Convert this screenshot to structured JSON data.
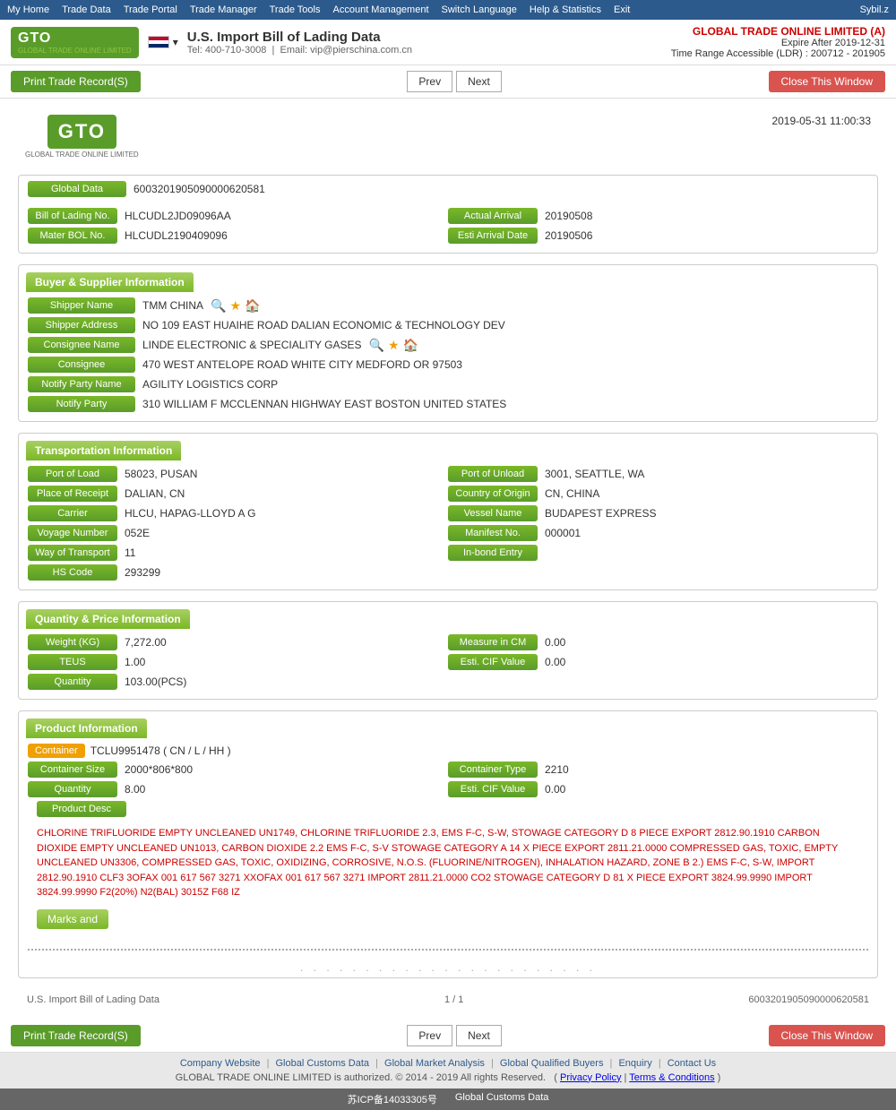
{
  "topnav": {
    "items": [
      "My Home",
      "Trade Data",
      "Trade Portal",
      "Trade Manager",
      "Trade Tools",
      "Account Management",
      "Switch Language",
      "Help & Statistics",
      "Exit"
    ],
    "user": "Sybil.z"
  },
  "header": {
    "logo": "GTO",
    "logo_sub": "GLOBAL TRADE ONLINE LIMITED",
    "flag_label": "US",
    "title": "U.S. Import Bill of Lading Data",
    "contact_tel": "Tel: 400-710-3008",
    "contact_email": "Email: vip@pierschina.com.cn",
    "company": "GLOBAL TRADE ONLINE LIMITED (A)",
    "expire": "Expire After 2019-12-31",
    "time_range": "Time Range Accessible (LDR) : 200712 - 201905"
  },
  "toolbar": {
    "print_label": "Print Trade Record(S)",
    "prev_label": "Prev",
    "next_label": "Next",
    "close_label": "Close This Window"
  },
  "record": {
    "timestamp": "2019-05-31 11:00:33",
    "global_data_label": "Global Data",
    "global_data_value": "6003201905090000620581",
    "bill_of_lading_label": "Bill of Lading No.",
    "bill_of_lading_value": "HLCUDL2JD09096AA",
    "actual_arrival_label": "Actual Arrival",
    "actual_arrival_value": "20190508",
    "mater_bol_label": "Mater BOL No.",
    "mater_bol_value": "HLCUDL2190409096",
    "esti_arrival_label": "Esti Arrival Date",
    "esti_arrival_value": "20190506"
  },
  "buyer_supplier": {
    "section_title": "Buyer & Supplier Information",
    "shipper_name_label": "Shipper Name",
    "shipper_name_value": "TMM CHINA",
    "shipper_address_label": "Shipper Address",
    "shipper_address_value": "NO 109 EAST HUAIHE ROAD DALIAN ECONOMIC & TECHNOLOGY DEV",
    "consignee_name_label": "Consignee Name",
    "consignee_name_value": "LINDE ELECTRONIC & SPECIALITY GASES",
    "consignee_label": "Consignee",
    "consignee_value": "470 WEST ANTELOPE ROAD WHITE CITY MEDFORD OR 97503",
    "notify_party_name_label": "Notify Party Name",
    "notify_party_name_value": "AGILITY LOGISTICS CORP",
    "notify_party_label": "Notify Party",
    "notify_party_value": "310 WILLIAM F MCCLENNAN HIGHWAY EAST BOSTON UNITED STATES"
  },
  "transportation": {
    "section_title": "Transportation Information",
    "port_of_load_label": "Port of Load",
    "port_of_load_value": "58023, PUSAN",
    "port_of_unload_label": "Port of Unload",
    "port_of_unload_value": "3001, SEATTLE, WA",
    "place_of_receipt_label": "Place of Receipt",
    "place_of_receipt_value": "DALIAN, CN",
    "country_of_origin_label": "Country of Origin",
    "country_of_origin_value": "CN, CHINA",
    "carrier_label": "Carrier",
    "carrier_value": "HLCU, HAPAG-LLOYD A G",
    "vessel_name_label": "Vessel Name",
    "vessel_name_value": "BUDAPEST EXPRESS",
    "voyage_number_label": "Voyage Number",
    "voyage_number_value": "052E",
    "manifest_no_label": "Manifest No.",
    "manifest_no_value": "000001",
    "way_of_transport_label": "Way of Transport",
    "way_of_transport_value": "11",
    "in_bond_entry_label": "In-bond Entry",
    "in_bond_entry_value": "",
    "hs_code_label": "HS Code",
    "hs_code_value": "293299"
  },
  "quantity_price": {
    "section_title": "Quantity & Price Information",
    "weight_label": "Weight (KG)",
    "weight_value": "7,272.00",
    "measure_cm_label": "Measure in CM",
    "measure_cm_value": "0.00",
    "teus_label": "TEUS",
    "teus_value": "1.00",
    "esti_cif_label": "Esti. CIF Value",
    "esti_cif_value": "0.00",
    "quantity_label": "Quantity",
    "quantity_value": "103.00(PCS)"
  },
  "product_info": {
    "section_title": "Product Information",
    "container_label": "Container",
    "container_badge": "Container",
    "container_value": "TCLU9951478 ( CN / L / HH )",
    "container_size_label": "Container Size",
    "container_size_value": "2000*806*800",
    "container_type_label": "Container Type",
    "container_type_value": "2210",
    "quantity_label": "Quantity",
    "quantity_value": "8.00",
    "esti_cif_label": "Esti. CIF Value",
    "esti_cif_value": "0.00",
    "product_desc_label": "Product Desc",
    "product_desc_text": "CHLORINE TRIFLUORIDE EMPTY UNCLEANED UN1749, CHLORINE TRIFLUORIDE 2.3, EMS F-C, S-W, STOWAGE CATEGORY D 8 PIECE EXPORT 2812.90.1910 CARBON DIOXIDE EMPTY UNCLEANED UN1013, CARBON DIOXIDE 2.2 EMS F-C, S-V STOWAGE CATEGORY A 14 X PIECE EXPORT 2811.21.0000 COMPRESSED GAS, TOXIC, EMPTY UNCLEANED UN3306, COMPRESSED GAS, TOXIC, OXIDIZING, CORROSIVE, N.O.S. (FLUORINE/NITROGEN), INHALATION HAZARD, ZONE B 2.) EMS F-C, S-W, IMPORT 2812.90.1910 CLF3 3OFAX 001 617 567 3271 XXOFAX 001 617 567 3271 IMPORT 2811.21.0000 CO2 STOWAGE CATEGORY D 81 X PIECE EXPORT 3824.99.9990 IMPORT 3824.99.9990 F2(20%) N2(BAL) 3015Z F68 IZ",
    "marks_label": "Marks and"
  },
  "record_footer": {
    "title": "U.S. Import Bill of Lading Data",
    "page": "1 / 1",
    "id": "6003201905090000620581"
  },
  "footer": {
    "company_website": "Company Website",
    "global_customs": "Global Customs Data",
    "global_market": "Global Market Analysis",
    "global_qualified": "Global Qualified Buyers",
    "enquiry": "Enquiry",
    "contact_us": "Contact Us",
    "copyright": "GLOBAL TRADE ONLINE LIMITED is authorized. © 2014 - 2019 All rights Reserved.",
    "privacy": "Privacy Policy",
    "terms": "Terms & Conditions"
  },
  "icp": {
    "icp_text": "苏ICP备14033305号",
    "global_customs_data": "Global Customs Data"
  }
}
